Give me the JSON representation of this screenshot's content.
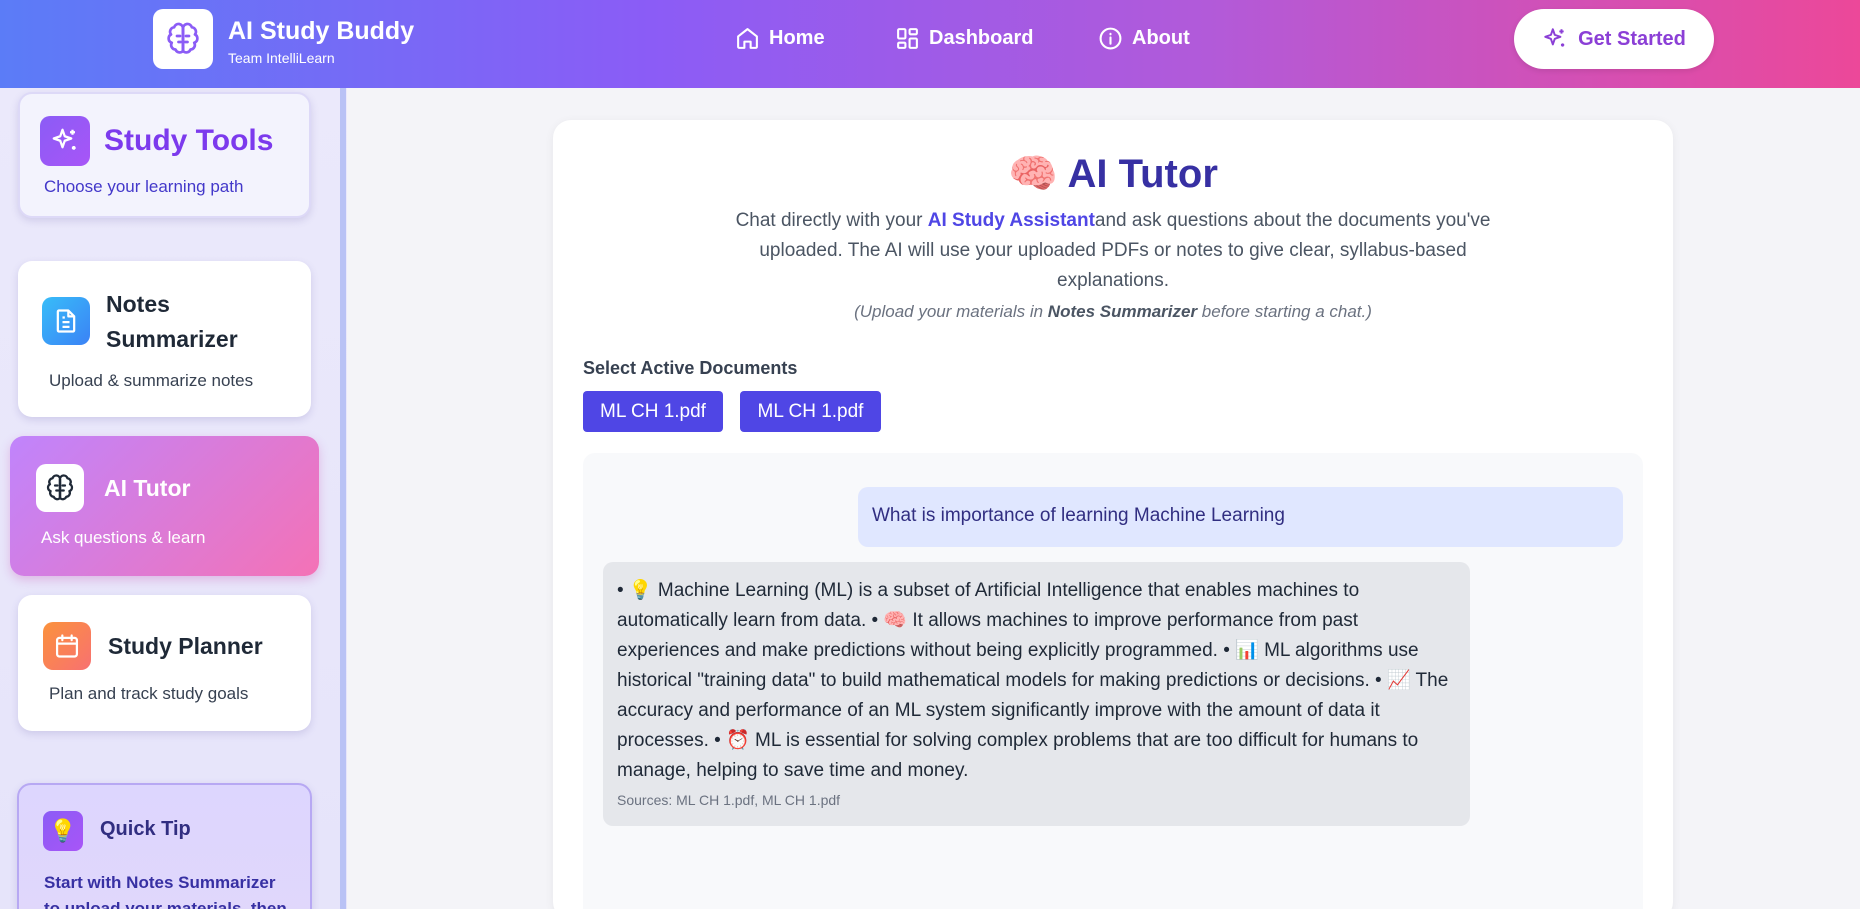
{
  "header": {
    "brand_title": "AI Study Buddy",
    "brand_subtitle": "Team IntelliLearn",
    "nav": [
      {
        "label": "Home",
        "icon": "home-icon"
      },
      {
        "label": "Dashboard",
        "icon": "dashboard-icon"
      },
      {
        "label": "About",
        "icon": "info-icon"
      }
    ],
    "cta_label": "Get Started"
  },
  "sidebar": {
    "heading": "Study Tools",
    "heading_sub": "Choose your learning path",
    "items": [
      {
        "title_line1": "Notes",
        "title_line2": "Summarizer",
        "subtitle": "Upload & summarize notes",
        "icon": "document-icon"
      },
      {
        "title": "AI Tutor",
        "subtitle": "Ask questions & learn",
        "icon": "brain-icon",
        "active": true
      },
      {
        "title": "Study Planner",
        "subtitle": "Plan and track study goals",
        "icon": "calendar-icon"
      }
    ],
    "tip": {
      "title": "Quick Tip",
      "icon": "lightbulb-icon",
      "text_line1": "Start with Notes Summarizer",
      "text_line2": "to upload your materials, then"
    }
  },
  "main": {
    "title_emoji": "🧠",
    "title": "AI Tutor",
    "desc_prefix": "Chat directly with your ",
    "desc_highlight": "AI Study Assistant",
    "desc_suffix": "and ask questions about the documents you've uploaded. The AI will use your uploaded PDFs or notes to give clear, syllabus-based explanations.",
    "note_prefix": "(Upload your materials in ",
    "note_bold": "Notes Summarizer",
    "note_suffix": " before starting a chat.)",
    "select_label": "Select Active Documents",
    "documents": [
      "ML CH 1.pdf",
      "ML CH 1.pdf"
    ],
    "chat": {
      "user_message": "What is importance of learning Machine Learning",
      "bot_message": "• 💡 Machine Learning (ML) is a subset of Artificial Intelligence that enables machines to automatically learn from data. • 🧠 It allows machines to improve performance from past experiences and make predictions without being explicitly programmed. • 📊 ML algorithms use historical \"training data\" to build mathematical models for making predictions or decisions. • 📈 The accuracy and performance of an ML system significantly improve with the amount of data it processes. • ⏰ ML is essential for solving complex problems that are too difficult for humans to manage, helping to save time and money.",
      "bot_sources": "Sources: ML CH 1.pdf, ML CH 1.pdf"
    }
  },
  "colors": {
    "accent": "#4f46e5",
    "brand_purple": "#7c3aed",
    "pink": "#ec4899"
  }
}
